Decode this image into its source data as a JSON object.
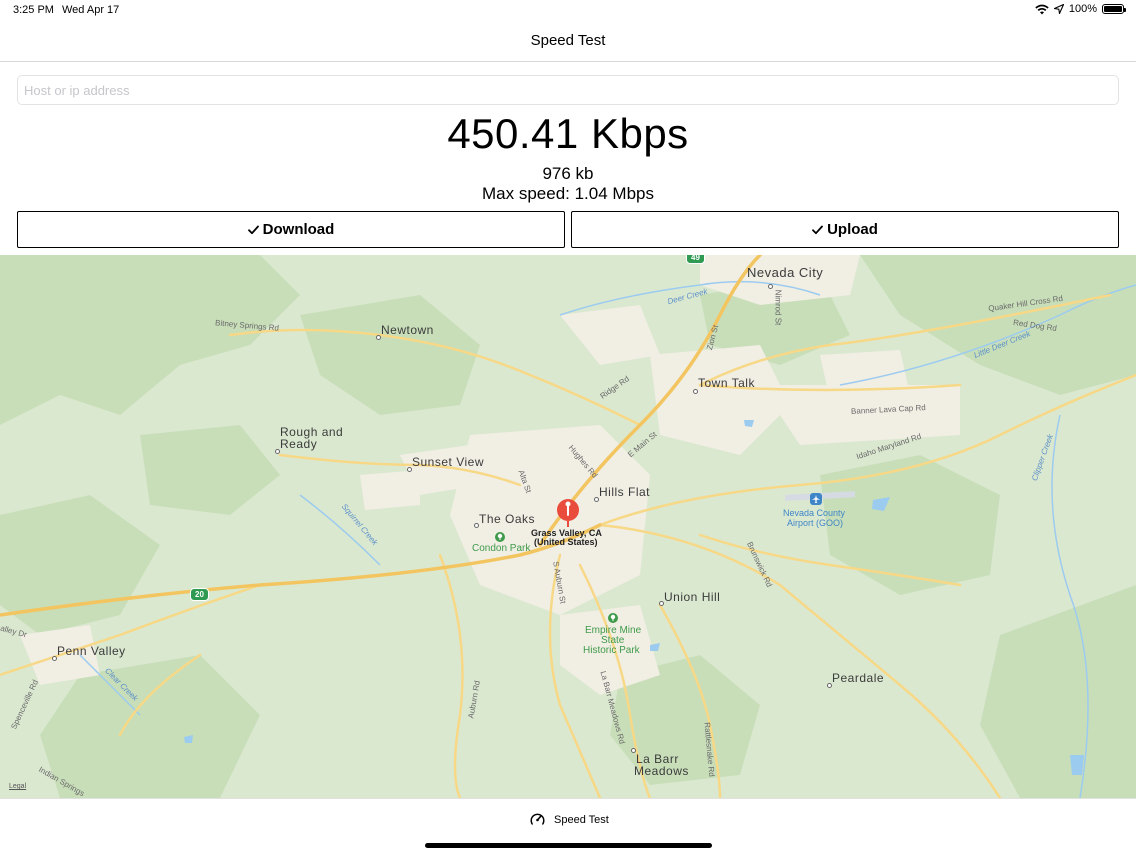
{
  "status_bar": {
    "time": "3:25 PM",
    "date": "Wed Apr 17",
    "battery": "100%",
    "icons": [
      "wifi-icon",
      "location-icon",
      "battery-icon"
    ]
  },
  "nav": {
    "title": "Speed Test"
  },
  "host": {
    "placeholder": "Host or ip address",
    "value": ""
  },
  "results": {
    "speed": "450.41 Kbps",
    "size": "976 kb",
    "max_speed": "Max speed: 1.04 Mbps"
  },
  "buttons": {
    "download": {
      "label": "Download",
      "checked": true
    },
    "upload": {
      "label": "Upload",
      "checked": true
    }
  },
  "map": {
    "places": {
      "nevada_city": "Nevada City",
      "newtown": "Newtown",
      "town_talk": "Town Talk",
      "rough_and": "Rough and",
      "ready": "Ready",
      "sunset_view": "Sunset View",
      "hills_flat": "Hills Flat",
      "the_oaks": "The Oaks",
      "union_hill": "Union Hill",
      "penn_valley": "Penn Valley",
      "peardale": "Peardale",
      "la_barr": "La Barr",
      "meadows": "Meadows"
    },
    "pin": {
      "line1": "Grass Valley, CA",
      "line2": "(United States)"
    },
    "parks": {
      "condon": "Condon Park",
      "empire_1": "Empire Mine",
      "empire_2": "State",
      "empire_3": "Historic Park"
    },
    "airport": {
      "line1": "Nevada County",
      "line2": "Airport (GOO)"
    },
    "roads": {
      "bitney": "Bitney Springs Rd",
      "ridge": "Ridge Rd",
      "hughes": "Hughes Rd",
      "e_main": "E Main St",
      "alta": "Alta St",
      "zion": "Zion St",
      "nimrod": "Nimrod St",
      "banner": "Banner Lava Cap Rd",
      "idaho": "Idaho Maryland Rd",
      "quaker": "Quaker Hill Cross Rd",
      "red_dog": "Red Dog Rd",
      "brunswick": "Brunswick Rd",
      "s_auburn": "S Auburn St",
      "auburn": "Auburn Rd",
      "la_barr_rd": "La Barr Meadows Rd",
      "rattlesnake": "Rattlesnake Rd",
      "spenceville": "Spenceville Rd",
      "indian_springs": "Indian Springs",
      "valley_dr": "alley Dr"
    },
    "water": {
      "deer": "Deer Creek",
      "little_deer": "Little Deer Creek",
      "squirrel": "Squirrel Creek",
      "clear": "Clear Creek",
      "clipper": "Clipper Creek"
    },
    "highways": {
      "hw49": "49",
      "hw20": "20"
    },
    "legal": "Legal",
    "colors": {
      "land": "#dbe8d0",
      "forest": "#c8deb9",
      "urban": "#f1eee4",
      "road": "#f7d886",
      "water": "#9ccbf0",
      "pin": "#e94b3c"
    }
  },
  "tab_bar": {
    "label": "Speed Test",
    "icon": "speedometer-icon"
  }
}
